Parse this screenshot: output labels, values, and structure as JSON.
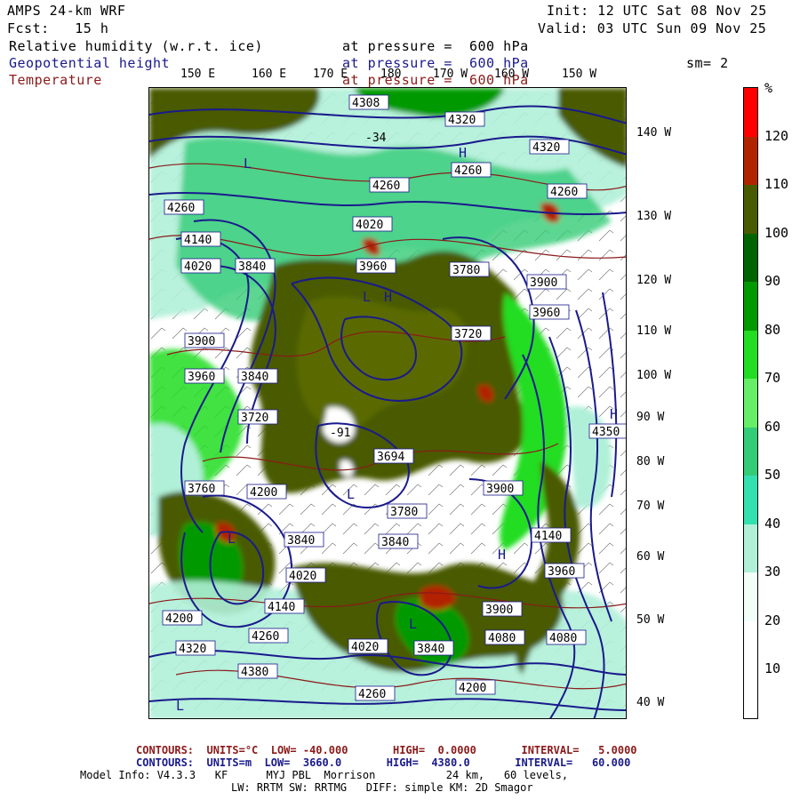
{
  "header": {
    "model": "AMPS 24-km WRF",
    "forecast": "Fcst:   15 h",
    "init": "Init: 12 UTC Sat 08 Nov 25",
    "valid": "Valid: 03 UTC Sun 09 Nov 25",
    "fields": [
      {
        "name": "Relative humidity (w.r.t. ice)",
        "level": "at pressure =  600 hPa"
      },
      {
        "name": "Geopotential height",
        "level": "at pressure =  600 hPa"
      },
      {
        "name": "Temperature",
        "level": "at pressure =  600 hPa"
      }
    ],
    "smoothing": "sm= 2"
  },
  "axes": {
    "top_lon_labels": [
      "150 E",
      "160 E",
      "170 E",
      "180",
      "170 W",
      "160 W",
      "150 W"
    ],
    "right_lon_labels": [
      "140 W",
      "130 W",
      "120 W",
      "110 W",
      "100 W",
      "90 W",
      "80 W",
      "70 W",
      "60 W",
      "50 W",
      "40 W"
    ]
  },
  "colorbar": {
    "unit": "%",
    "ticks": [
      "120",
      "110",
      "100",
      "90",
      "80",
      "70",
      "60",
      "50",
      "40",
      "30",
      "20",
      "10"
    ],
    "colors": [
      "#ff0000",
      "#b22400",
      "#4a5a00",
      "#006400",
      "#009a00",
      "#22dd22",
      "#66ee66",
      "#33cc77",
      "#33e0b0",
      "#b0f0d8",
      "#f2fff8",
      "#ffffff",
      "#ffffff"
    ]
  },
  "chart_data": {
    "type": "heatmap",
    "title": "Relative humidity (w.r.t. ice) at pressure = 600 hPa",
    "height_contour_labels": [
      4308,
      4320,
      4320,
      4260,
      4260,
      4260,
      4260,
      4140,
      4020,
      3840,
      4020,
      3960,
      3900,
      3960,
      3780,
      3720,
      3900,
      3960,
      3840,
      3694,
      3720,
      3780,
      3840,
      3840,
      4020,
      4140,
      4020,
      4200,
      4260,
      4260,
      4200,
      4080,
      4080,
      4140,
      3900,
      3840,
      3960,
      4380,
      4320,
      4200,
      3760,
      3900,
      4350
    ],
    "legend_range": [
      0,
      130
    ],
    "legend_ticks": [
      10,
      20,
      30,
      40,
      50,
      60,
      70,
      80,
      90,
      100,
      110,
      120
    ]
  },
  "map_labels": {
    "low_markers": [
      "L",
      "L",
      "L",
      "L",
      "L",
      "L"
    ],
    "high_markers": [
      "H",
      "H",
      "H",
      "H"
    ],
    "temp_label_1": "-91",
    "temp_label_2": "-34"
  },
  "footer": {
    "contours_temp": "CONTOURS:  UNITS=°C  LOW= -40.000       HIGH=  0.0000       INTERVAL=   5.0000",
    "contours_hgt": "CONTOURS:  UNITS=m  LOW=  3660.0       HIGH=  4380.0       INTERVAL=   60.000",
    "model_info": "Model Info: V4.3.3   KF      MYJ PBL  Morrison           24 km,   60 levels,",
    "model_info_2": "LW: RRTM SW: RRTMG   DIFF: simple KM: 2D Smagor"
  }
}
